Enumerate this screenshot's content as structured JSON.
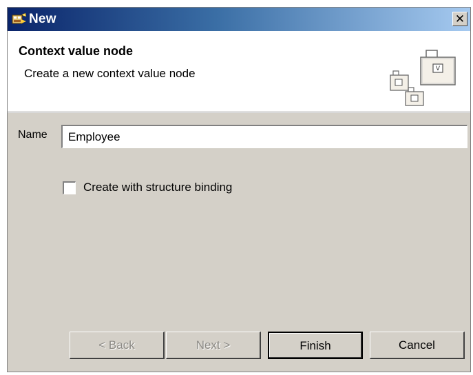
{
  "window": {
    "title": "New",
    "icon": "wizard-icon",
    "close_icon": "close-icon",
    "close_glyph": "✕"
  },
  "header": {
    "title": "Context value node",
    "description": "Create a new context value node",
    "icon": "context-node-icon"
  },
  "form": {
    "name_label": "Name",
    "name_value": "Employee",
    "checkbox_label": "Create with structure binding",
    "checkbox_checked": false
  },
  "buttons": {
    "back": "< Back",
    "next": "Next >",
    "finish": "Finish",
    "cancel": "Cancel"
  },
  "colors": {
    "titlebar_start": "#0a246a",
    "titlebar_end": "#a6caf0",
    "dialog_bg": "#d4d0c8",
    "disabled_text": "#8c8a85"
  }
}
